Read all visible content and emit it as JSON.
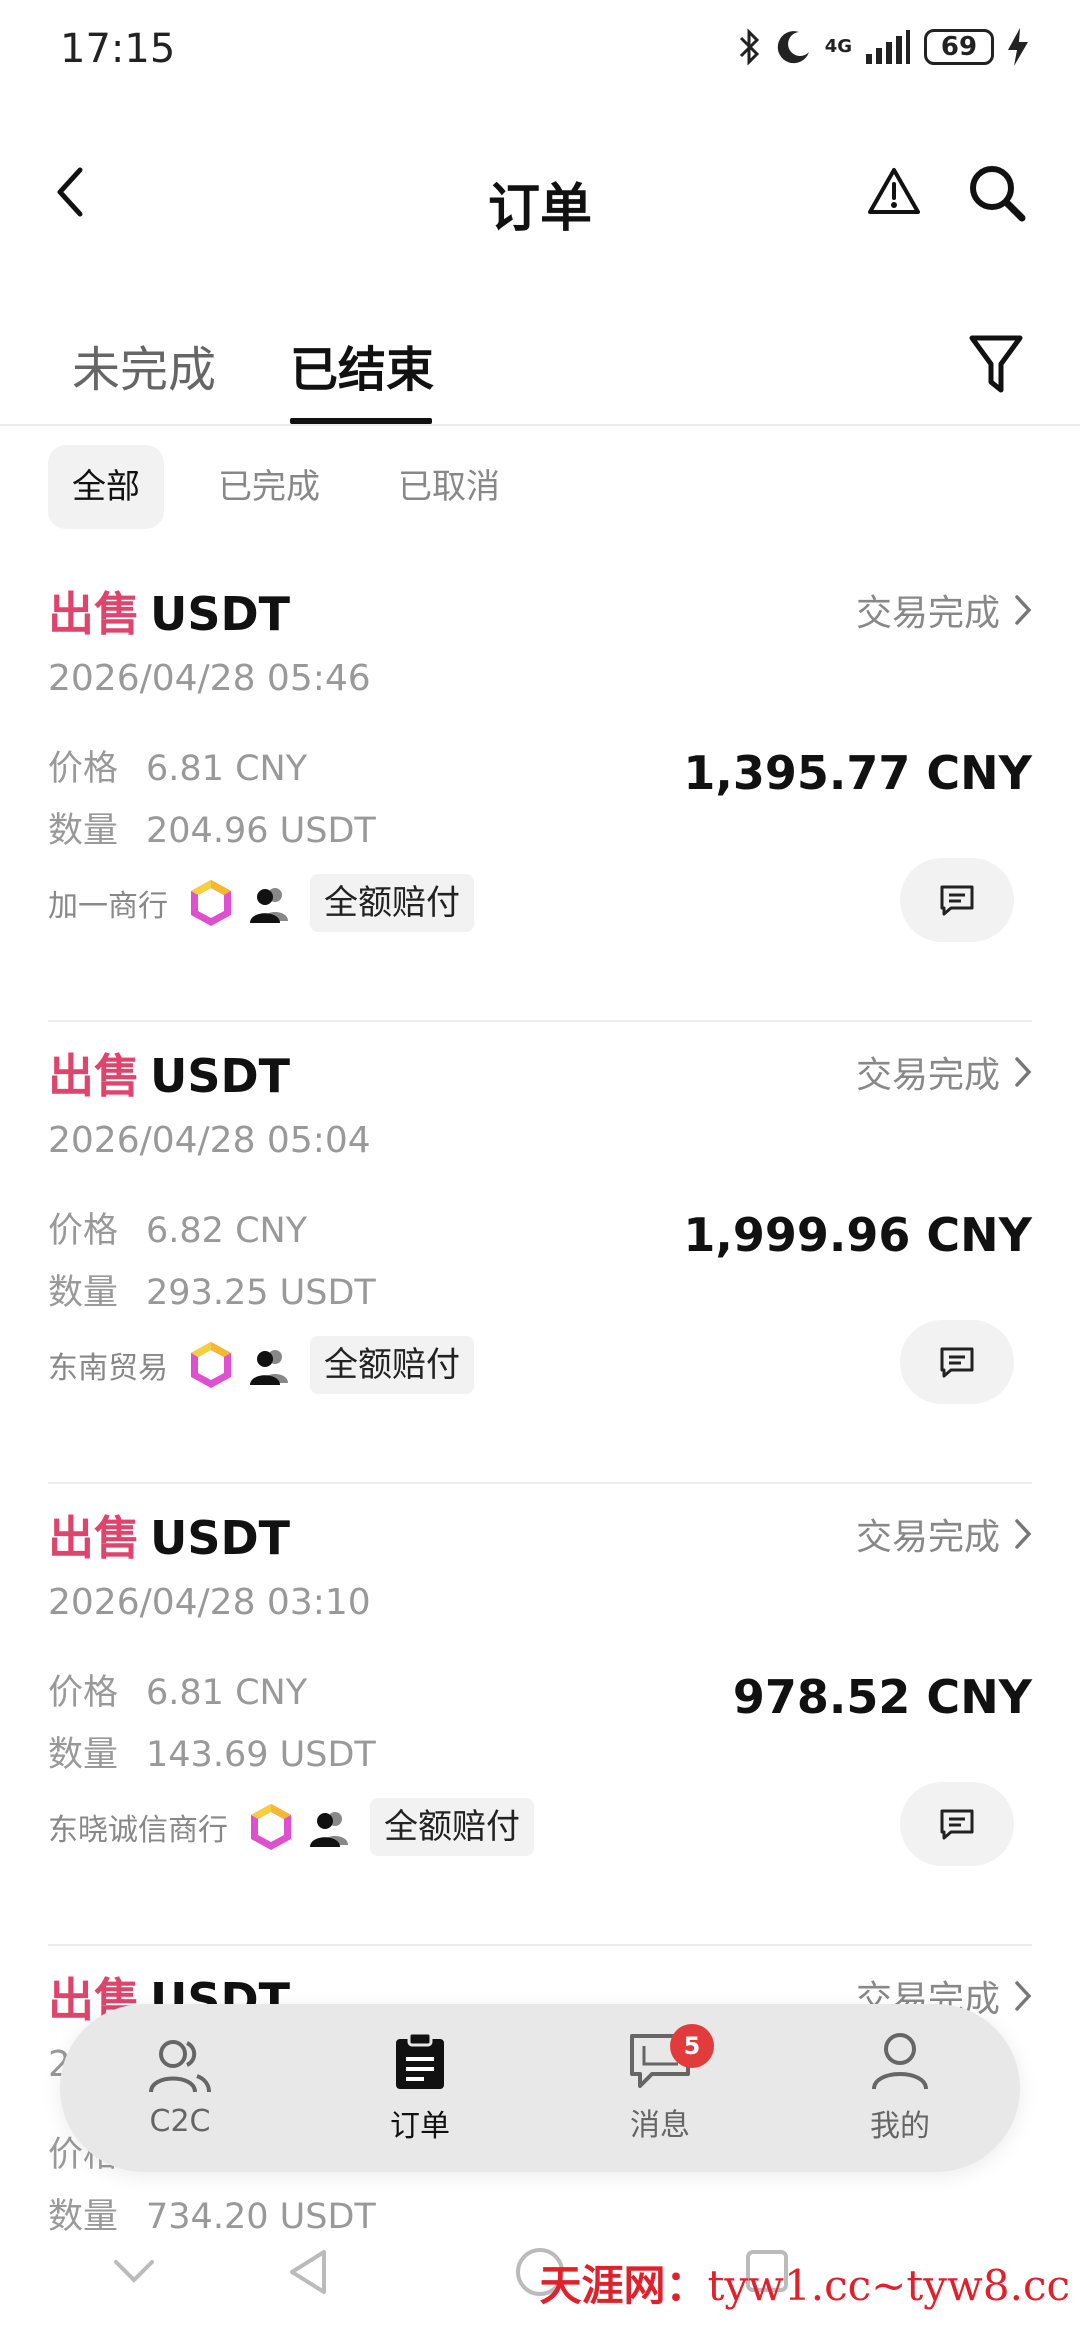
{
  "status_bar": {
    "time": "17:15",
    "network": "4G",
    "battery": "69",
    "icons": [
      "bluetooth-icon",
      "moon-icon",
      "signal-icon",
      "battery-icon",
      "charging-icon"
    ]
  },
  "header": {
    "title": "订单"
  },
  "tabs": [
    {
      "label": "未完成",
      "active": false
    },
    {
      "label": "已结束",
      "active": true
    }
  ],
  "filter_chips": [
    {
      "label": "全部",
      "active": true
    },
    {
      "label": "已完成",
      "active": false
    },
    {
      "label": "已取消",
      "active": false
    }
  ],
  "orders": [
    {
      "side": "出售",
      "asset": "USDT",
      "status": "交易完成",
      "date": "2026/04/28 05:46",
      "price_label": "价格",
      "price": "6.81 CNY",
      "qty_label": "数量",
      "qty": "204.96 USDT",
      "amount": "1,395.77 CNY",
      "merchant": "加一商行",
      "guarantee": "全额赔付"
    },
    {
      "side": "出售",
      "asset": "USDT",
      "status": "交易完成",
      "date": "2026/04/28 05:04",
      "price_label": "价格",
      "price": "6.82 CNY",
      "qty_label": "数量",
      "qty": "293.25 USDT",
      "amount": "1,999.96 CNY",
      "merchant": "东南贸易",
      "guarantee": "全额赔付"
    },
    {
      "side": "出售",
      "asset": "USDT",
      "status": "交易完成",
      "date": "2026/04/28 03:10",
      "price_label": "价格",
      "price": "6.81 CNY",
      "qty_label": "数量",
      "qty": "143.69 USDT",
      "amount": "978.52 CNY",
      "merchant": "东晓诚信商行",
      "guarantee": "全额赔付"
    },
    {
      "side": "出售",
      "asset": "USDT",
      "status": "交易完成",
      "date": "2",
      "price_label": "价格",
      "price": "",
      "qty_label": "数量",
      "qty": "734.20 USDT",
      "amount": "",
      "merchant": "",
      "guarantee": ""
    }
  ],
  "bottom_nav": [
    {
      "label": "C2C",
      "icon": "users-icon",
      "active": false
    },
    {
      "label": "订单",
      "icon": "clipboard-icon",
      "active": true
    },
    {
      "label": "消息",
      "icon": "message-icon",
      "active": false,
      "badge": "5"
    },
    {
      "label": "我的",
      "icon": "user-icon",
      "active": false
    }
  ],
  "watermark": {
    "brand": "天涯网：",
    "text": "tyw1.cc~tyw8.cc"
  },
  "colors": {
    "sell": "#e0436b",
    "badge": "#e23b3b",
    "watermark": "#e0202a"
  }
}
